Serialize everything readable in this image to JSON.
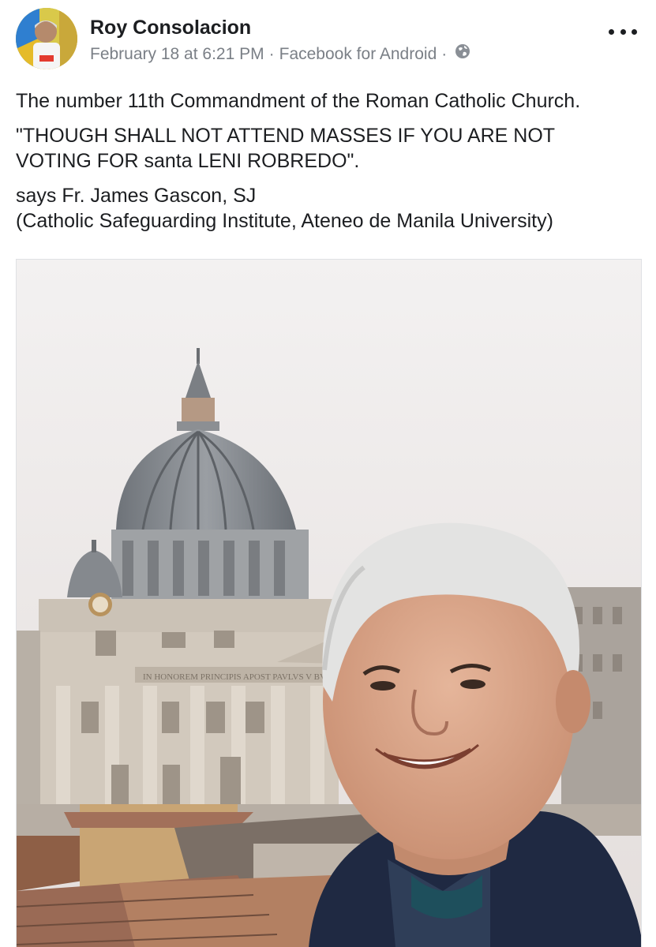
{
  "post": {
    "author_name": "Roy Consolacion",
    "date": "February 18 at 6:21 PM",
    "separator": "·",
    "source": "Facebook for Android",
    "privacy_icon": "globe-icon",
    "menu_icon": "more-options-icon",
    "text_line_1": "The number 11th Commandment of the Roman Catholic Church.",
    "text_quote_1": "\"THOUGH SHALL NOT ATTEND MASSES IF YOU ARE NOT",
    "text_quote_2": "VOTING FOR santa LENI ROBREDO\".",
    "attribution_1": "says Fr. James Gascon, SJ",
    "attribution_2": "(Catholic Safeguarding Institute, Ateneo de Manila University)"
  },
  "photo": {
    "inscription": "IN HONOREM PRINCIPIS APOST PAVLVS V BVRGHESIVS"
  },
  "colors": {
    "text": "#1c1e21",
    "meta": "#7a7f86",
    "sky": "#ece8e6",
    "dome": "#7d8288",
    "facade": "#cfc6ba",
    "jacket": "#1f2942"
  }
}
